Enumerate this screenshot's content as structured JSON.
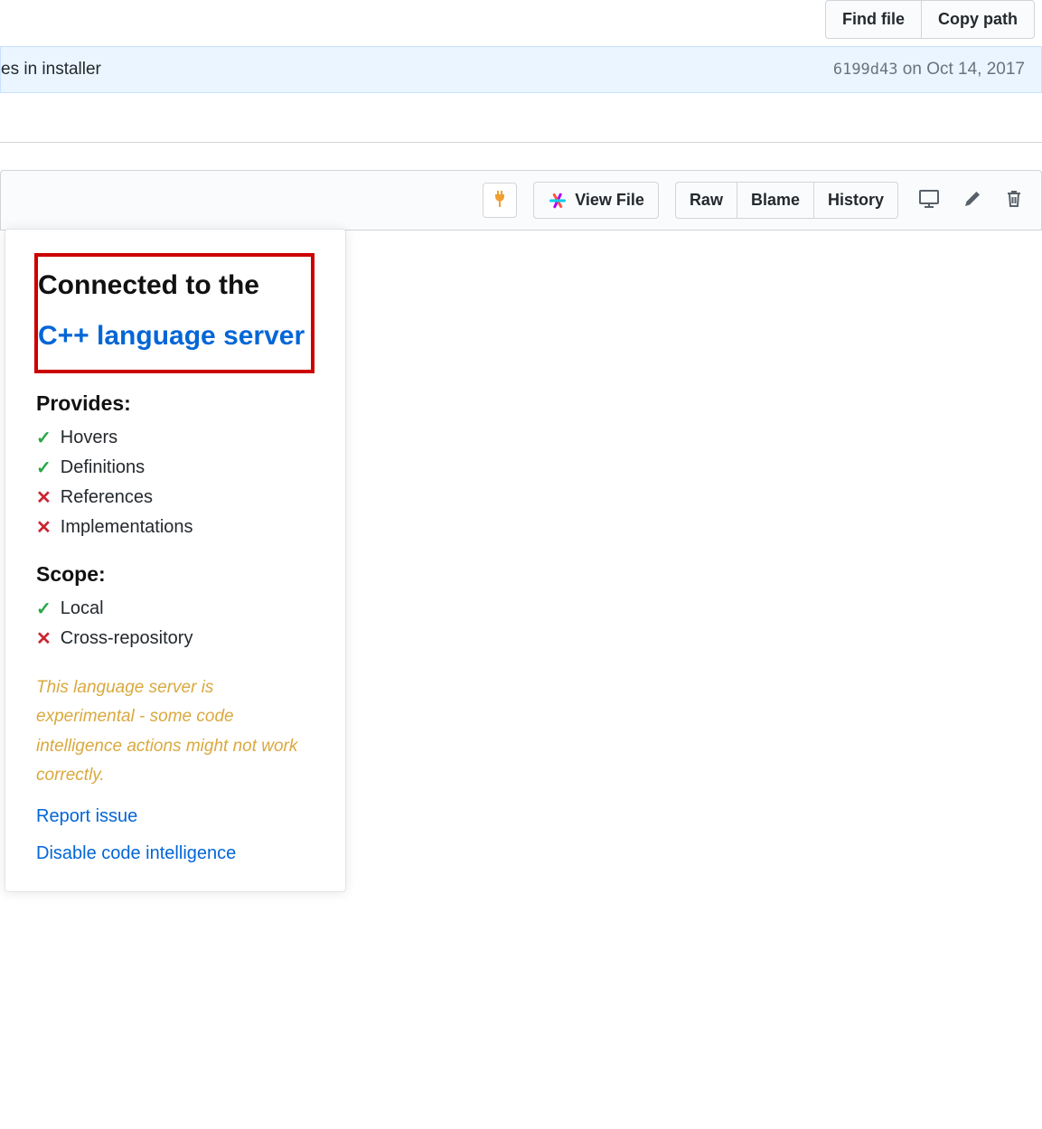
{
  "top_buttons": {
    "find_file": "Find file",
    "copy_path": "Copy path"
  },
  "commit": {
    "message_tail": "es in installer",
    "sha": "6199d43",
    "date": "on Oct 14, 2017"
  },
  "toolbar": {
    "view_file": "View File",
    "raw": "Raw",
    "blame": "Blame",
    "history": "History"
  },
  "popover": {
    "title_prefix": "Connected to the ",
    "title_link": "C++ language server",
    "provides_heading": "Provides:",
    "provides": [
      {
        "ok": true,
        "label": "Hovers"
      },
      {
        "ok": true,
        "label": "Definitions"
      },
      {
        "ok": false,
        "label": "References"
      },
      {
        "ok": false,
        "label": "Implementations"
      }
    ],
    "scope_heading": "Scope:",
    "scope": [
      {
        "ok": true,
        "label": "Local"
      },
      {
        "ok": false,
        "label": "Cross-repository"
      }
    ],
    "warning": "This language server is experimental - some code intelligence actions might not work correctly.",
    "report_issue": "Report issue",
    "disable": "Disable code intelligence"
  }
}
